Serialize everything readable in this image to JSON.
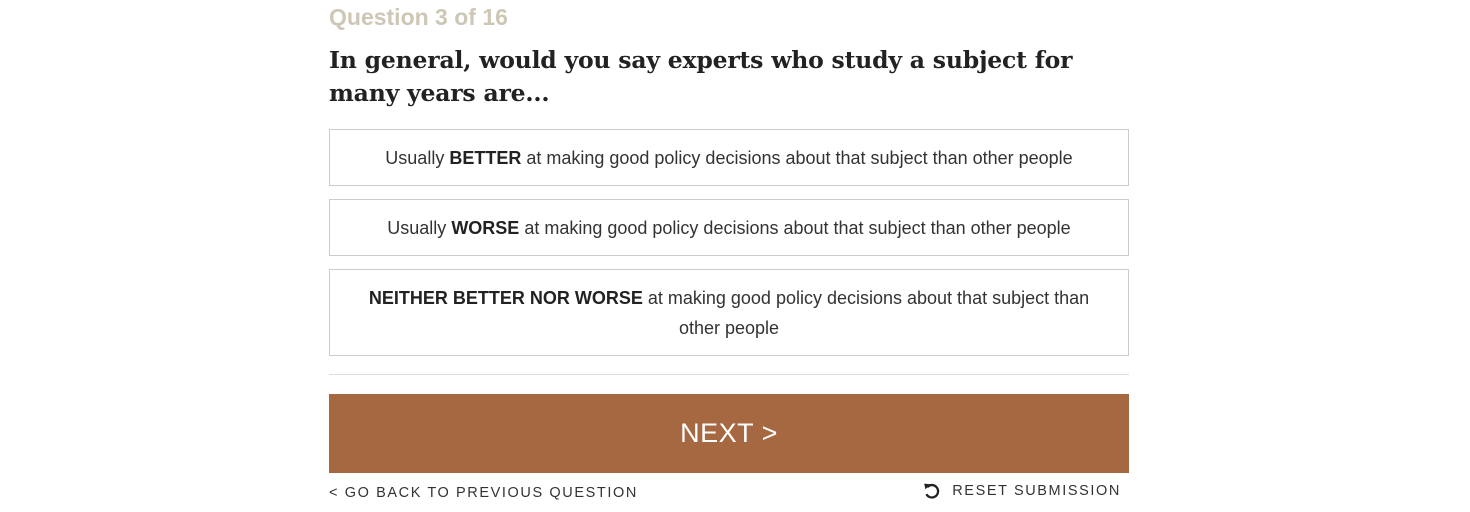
{
  "quiz": {
    "progress": "Question 3 of 16",
    "question": "In general, would you say experts who study a subject for many years are...",
    "options": [
      {
        "prefix": "Usually ",
        "emphasis": "BETTER",
        "rest": " at making good policy decisions about that subject than other people"
      },
      {
        "prefix": "Usually ",
        "emphasis": "WORSE",
        "rest": " at making good policy decisions about that subject than other people"
      },
      {
        "prefix": "",
        "emphasis": "NEITHER BETTER NOR WORSE",
        "rest": " at making good policy decisions about that subject than other people"
      }
    ],
    "next_label": "NEXT >",
    "back_label": "< GO BACK TO PREVIOUS QUESTION",
    "reset_label": "RESET SUBMISSION",
    "reset_icon": "undo-arrow-icon"
  },
  "colors": {
    "accent": "#a56841",
    "progress_text": "#cdc7b6",
    "border": "#cccccc"
  }
}
